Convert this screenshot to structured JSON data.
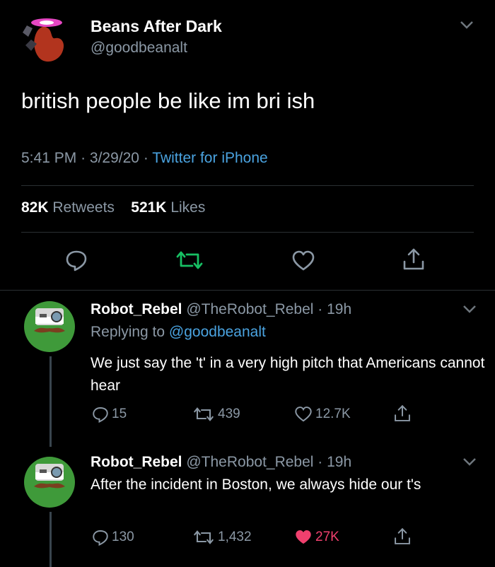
{
  "main": {
    "display_name": "Beans After Dark",
    "handle": "@goodbeanalt",
    "text": "british people be like im bri ish",
    "time": "5:41 PM",
    "date": "3/29/20",
    "separator": "·",
    "source": "Twitter for iPhone",
    "retweets_count": "82K",
    "retweets_label": "Retweets",
    "likes_count": "521K",
    "likes_label": "Likes"
  },
  "replies": [
    {
      "display_name": "Robot_Rebel",
      "handle": "@TheRobot_Rebel",
      "age": "· 19h",
      "replying_prefix": "Replying to",
      "replying_to": "@goodbeanalt",
      "text": "We just say the 't' in a very high pitch that Americans cannot hear",
      "reply_count": "15",
      "retweet_count": "439",
      "like_count": "12.7K"
    },
    {
      "display_name": "Robot_Rebel",
      "handle": "@TheRobot_Rebel",
      "age": "· 19h",
      "text": "After the incident in Boston, we always hide our t's",
      "reply_count": "130",
      "retweet_count": "1,432",
      "like_count": "27K",
      "liked": true
    }
  ],
  "colors": {
    "background": "#000000",
    "link": "#4aa3e0",
    "retweet_green": "#17bf63",
    "like_pink": "#f0406e",
    "muted": "#8b98a5"
  },
  "icons": [
    "bean-avatar-icon",
    "chevron-down-icon",
    "reply-icon",
    "retweet-icon",
    "heart-icon",
    "share-icon",
    "robot-avatar-icon"
  ]
}
